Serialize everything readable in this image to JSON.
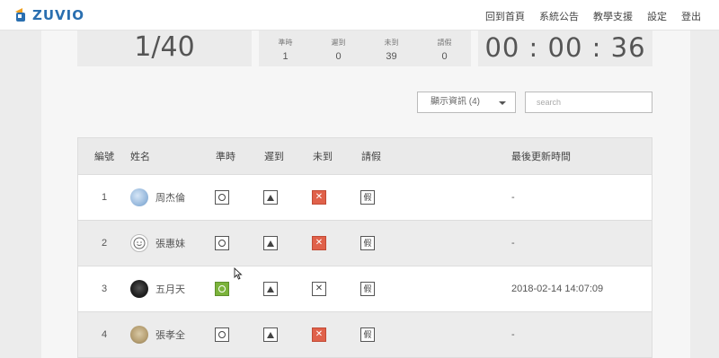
{
  "header": {
    "logo_text": "ZUVIO",
    "nav": [
      "回到首頁",
      "系統公告",
      "教學支援",
      "設定",
      "登出"
    ]
  },
  "stats": {
    "attempt": "1/40",
    "counts": [
      {
        "label": "準時",
        "value": "1"
      },
      {
        "label": "遲到",
        "value": "0"
      },
      {
        "label": "未到",
        "value": "39"
      },
      {
        "label": "請假",
        "value": "0"
      }
    ],
    "timer": "00 : 00 : 36"
  },
  "filters": {
    "display_info": "顯示資訊 (4)",
    "search_placeholder": "search"
  },
  "table": {
    "headers": {
      "num": "編號",
      "name": "姓名",
      "ontime": "準時",
      "late": "遲到",
      "absent": "未到",
      "leave": "請假",
      "updated": "最後更新時間"
    },
    "rows": [
      {
        "num": "1",
        "name": "周杰倫",
        "ontime": "○",
        "late": "△",
        "absent": "✕",
        "leave": "假",
        "updated": "-"
      },
      {
        "num": "2",
        "name": "張惠妹",
        "ontime": "○",
        "late": "△",
        "absent": "✕",
        "leave": "假",
        "updated": "-"
      },
      {
        "num": "3",
        "name": "五月天",
        "ontime": "○",
        "late": "△",
        "absent": "✕",
        "leave": "假",
        "updated": "2018-02-14 14:07:09"
      },
      {
        "num": "4",
        "name": "張孝全",
        "ontime": "○",
        "late": "△",
        "absent": "✕",
        "leave": "假",
        "updated": "-"
      }
    ]
  },
  "colors": {
    "active_ontime": "#7bb33b",
    "active_absent": "#e0614a",
    "brand": "#2a6fb0"
  }
}
